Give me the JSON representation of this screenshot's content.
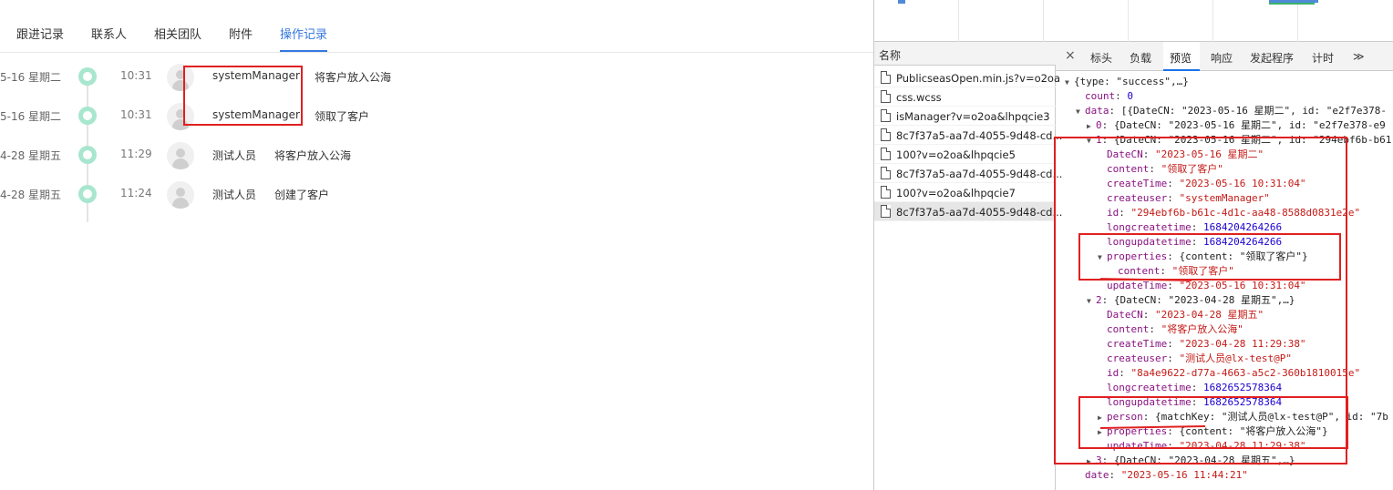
{
  "app": {
    "tabs": [
      {
        "label": "跟进记录",
        "active": false
      },
      {
        "label": "联系人",
        "active": false
      },
      {
        "label": "相关团队",
        "active": false
      },
      {
        "label": "附件",
        "active": false
      },
      {
        "label": "操作记录",
        "active": true
      }
    ],
    "timeline": [
      {
        "date": "5-16 星期二",
        "time": "10:31",
        "user": "systemManager",
        "action": "将客户放入公海"
      },
      {
        "date": "5-16 星期二",
        "time": "10:31",
        "user": "systemManager",
        "action": "领取了客户"
      },
      {
        "date": "4-28 星期五",
        "time": "11:29",
        "user": "测试人员",
        "action": "将客户放入公海"
      },
      {
        "date": "4-28 星期五",
        "time": "11:24",
        "user": "测试人员",
        "action": "创建了客户"
      }
    ],
    "accent_color": "#3478e0",
    "dot_color": "#a8e6cf"
  },
  "devtools": {
    "name_header": "名称",
    "requests": [
      {
        "name": "PublicseasOpen.min.js?v=o2oa",
        "selected": false
      },
      {
        "name": "css.wcss",
        "selected": false
      },
      {
        "name": "isManager?v=o2oa&lhpqcie3",
        "selected": false
      },
      {
        "name": "8c7f37a5-aa7d-4055-9d48-cd...",
        "selected": false
      },
      {
        "name": "100?v=o2oa&lhpqcie5",
        "selected": false
      },
      {
        "name": "8c7f37a5-aa7d-4055-9d48-cd...",
        "selected": false
      },
      {
        "name": "100?v=o2oa&lhpqcie7",
        "selected": false
      },
      {
        "name": "8c7f37a5-aa7d-4055-9d48-cd...",
        "selected": true
      }
    ],
    "preview_tabs": {
      "close": "×",
      "items": [
        "标头",
        "负载",
        "预览",
        "响应",
        "发起程序",
        "计时"
      ],
      "active": "预览",
      "more": "≫"
    },
    "json_lines": [
      {
        "indent": 0,
        "tri": "▼",
        "key": "",
        "value": "{type: \"success\",…}",
        "vtype": "p"
      },
      {
        "indent": 1,
        "tri": "",
        "key": "count",
        "value": "0",
        "vtype": "n"
      },
      {
        "indent": 1,
        "tri": "▼",
        "key": "data",
        "value": "[{DateCN: \"2023-05-16 星期二\", id: \"e2f7e378-",
        "vtype": "p"
      },
      {
        "indent": 2,
        "tri": "▶",
        "key": "0",
        "value": "{DateCN: \"2023-05-16 星期二\", id: \"e2f7e378-e9",
        "vtype": "p"
      },
      {
        "indent": 2,
        "tri": "▼",
        "key": "1",
        "value": "{DateCN: \"2023-05-16 星期二\", id: \"294ebf6b-b61",
        "vtype": "p"
      },
      {
        "indent": 3,
        "tri": "",
        "key": "DateCN",
        "value": "\"2023-05-16 星期二\"",
        "vtype": "s"
      },
      {
        "indent": 3,
        "tri": "",
        "key": "content",
        "value": "\"领取了客户\"",
        "vtype": "s"
      },
      {
        "indent": 3,
        "tri": "",
        "key": "createTime",
        "value": "\"2023-05-16 10:31:04\"",
        "vtype": "s"
      },
      {
        "indent": 3,
        "tri": "",
        "key": "createuser",
        "value": "\"systemManager\"",
        "vtype": "s"
      },
      {
        "indent": 3,
        "tri": "",
        "key": "id",
        "value": "\"294ebf6b-b61c-4d1c-aa48-8588d0831e2e\"",
        "vtype": "s"
      },
      {
        "indent": 3,
        "tri": "",
        "key": "longcreatetime",
        "value": "1684204264266",
        "vtype": "n"
      },
      {
        "indent": 3,
        "tri": "",
        "key": "longupdatetime",
        "value": "1684204264266",
        "vtype": "n"
      },
      {
        "indent": 3,
        "tri": "▼",
        "key": "properties",
        "value": "{content: \"领取了客户\"}",
        "vtype": "p"
      },
      {
        "indent": 4,
        "tri": "",
        "key": "content",
        "value": "\"领取了客户\"",
        "vtype": "s"
      },
      {
        "indent": 3,
        "tri": "",
        "key": "updateTime",
        "value": "\"2023-05-16 10:31:04\"",
        "vtype": "s"
      },
      {
        "indent": 2,
        "tri": "▼",
        "key": "2",
        "value": "{DateCN: \"2023-04-28 星期五\",…}",
        "vtype": "p"
      },
      {
        "indent": 3,
        "tri": "",
        "key": "DateCN",
        "value": "\"2023-04-28 星期五\"",
        "vtype": "s"
      },
      {
        "indent": 3,
        "tri": "",
        "key": "content",
        "value": "\"将客户放入公海\"",
        "vtype": "s"
      },
      {
        "indent": 3,
        "tri": "",
        "key": "createTime",
        "value": "\"2023-04-28 11:29:38\"",
        "vtype": "s"
      },
      {
        "indent": 3,
        "tri": "",
        "key": "createuser",
        "value": "\"测试人员@lx-test@P\"",
        "vtype": "s"
      },
      {
        "indent": 3,
        "tri": "",
        "key": "id",
        "value": "\"8a4e9622-d77a-4663-a5c2-360b1810015e\"",
        "vtype": "s"
      },
      {
        "indent": 3,
        "tri": "",
        "key": "longcreatetime",
        "value": "1682652578364",
        "vtype": "n"
      },
      {
        "indent": 3,
        "tri": "",
        "key": "longupdatetime",
        "value": "1682652578364",
        "vtype": "n"
      },
      {
        "indent": 3,
        "tri": "▶",
        "key": "person",
        "value": "{matchKey: \"测试人员@lx-test@P\", id: \"7b",
        "vtype": "p"
      },
      {
        "indent": 3,
        "tri": "▶",
        "key": "properties",
        "value": "{content: \"将客户放入公海\"}",
        "vtype": "p"
      },
      {
        "indent": 3,
        "tri": "",
        "key": "updateTime",
        "value": "\"2023-04-28 11:29:38\"",
        "vtype": "s"
      },
      {
        "indent": 2,
        "tri": "▶",
        "key": "3",
        "value": "{DateCN: \"2023-04-28 星期五\",…}",
        "vtype": "p"
      },
      {
        "indent": 1,
        "tri": "",
        "key": "date",
        "value": "\"2023-05-16 11:44:21\"",
        "vtype": "s"
      }
    ]
  }
}
